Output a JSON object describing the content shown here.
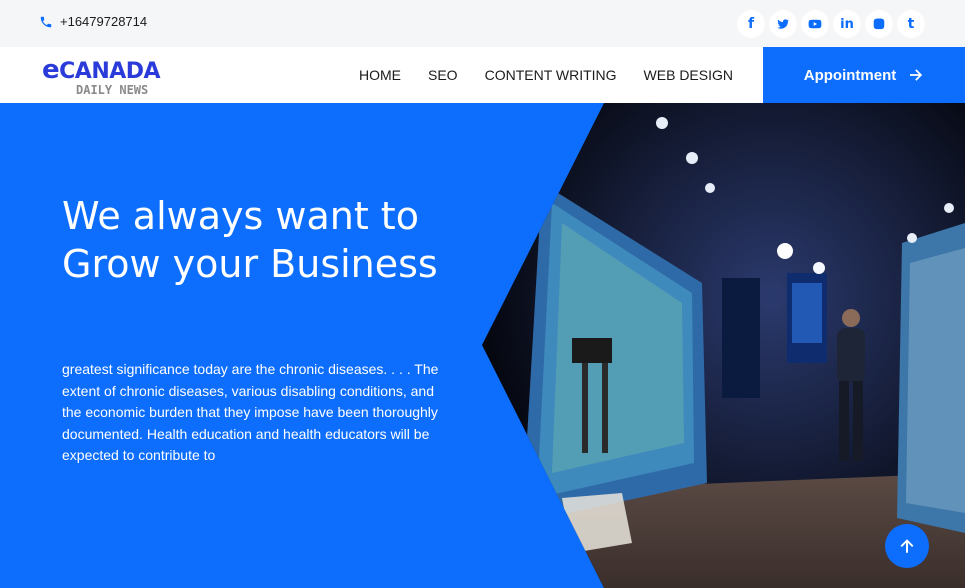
{
  "topbar": {
    "phone": "+16479728714",
    "socials": [
      {
        "name": "facebook-icon",
        "glyph": "f"
      },
      {
        "name": "twitter-icon",
        "glyph": ""
      },
      {
        "name": "youtube-icon",
        "glyph": ""
      },
      {
        "name": "linkedin-icon",
        "glyph": "in"
      },
      {
        "name": "instagram-icon",
        "glyph": ""
      },
      {
        "name": "tumblr-icon",
        "glyph": "t"
      }
    ]
  },
  "nav": {
    "logo_top": "CANADA",
    "logo_e": "e",
    "logo_bottom": "DAILY NEWS",
    "links": [
      "HOME",
      "SEO",
      "CONTENT WRITING",
      "WEB DESIGN"
    ],
    "cta": "Appointment"
  },
  "hero": {
    "title": "We always want to Grow your Business",
    "text": "greatest significance today are the chronic diseases. . . . The extent of chronic diseases, various disabling conditions, and the economic burden that they impose have been thoroughly documented. Health education and health educators will be expected to contribute to"
  },
  "colors": {
    "accent": "#0d6efd",
    "logo": "#2a3bd9"
  }
}
